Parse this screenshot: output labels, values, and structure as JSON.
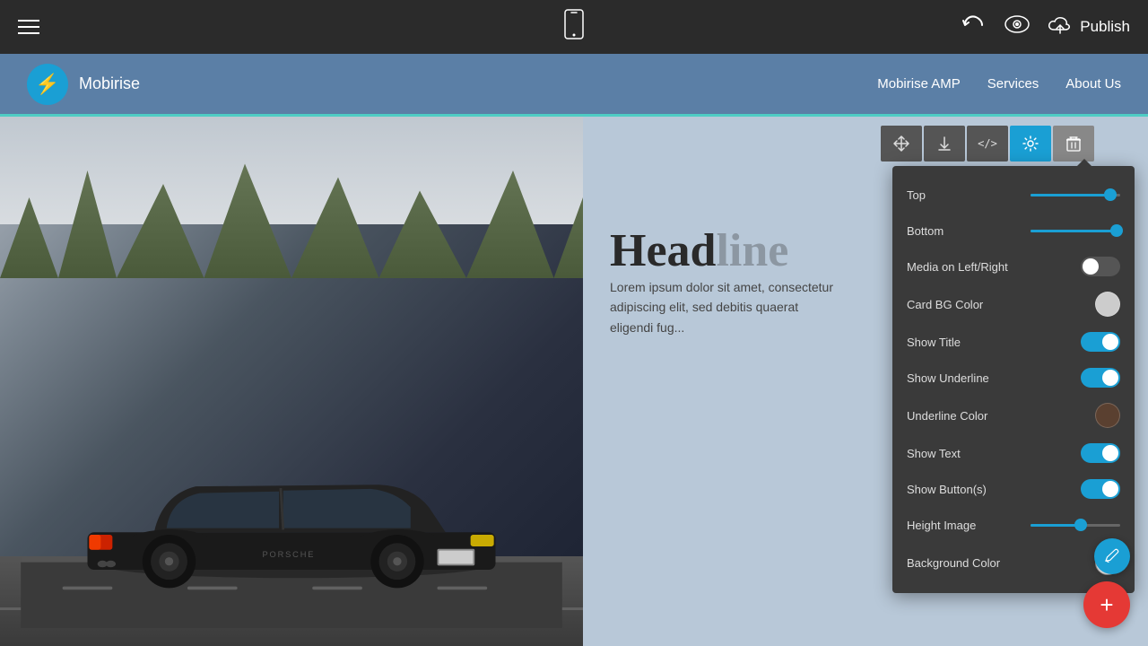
{
  "topbar": {
    "publish_label": "Publish",
    "phone_icon": "📱",
    "undo_icon": "↩",
    "eye_icon": "👁",
    "cloud_icon": "☁"
  },
  "site_header": {
    "logo_icon": "⚡",
    "site_name": "Mobirise",
    "nav": [
      {
        "label": "Mobirise AMP"
      },
      {
        "label": "Services"
      },
      {
        "label": "About Us"
      }
    ]
  },
  "content": {
    "heading": "Head",
    "body_text": "Lorem ipsum dolor sit amet, consectetur adipiscing elit, sed debitis quaerat eligendi fug..."
  },
  "settings_panel": {
    "title": "Settings",
    "rows": [
      {
        "label": "Top",
        "control": "slider",
        "value": 90
      },
      {
        "label": "Bottom",
        "control": "slider",
        "value": 95
      },
      {
        "label": "Media on Left/Right",
        "control": "toggle",
        "state": "off"
      },
      {
        "label": "Card BG Color",
        "control": "color",
        "color": "#cccccc"
      },
      {
        "label": "Show Title",
        "control": "toggle",
        "state": "on"
      },
      {
        "label": "Show Underline",
        "control": "toggle",
        "state": "on"
      },
      {
        "label": "Underline Color",
        "control": "color",
        "color": "#5a4030"
      },
      {
        "label": "Show Text",
        "control": "toggle",
        "state": "on"
      },
      {
        "label": "Show Button(s)",
        "control": "toggle",
        "state": "on"
      },
      {
        "label": "Height Image",
        "control": "slider",
        "value": 55
      },
      {
        "label": "Background Color",
        "control": "color",
        "color": "#ffffff"
      }
    ]
  },
  "toolbar": {
    "buttons": [
      {
        "icon": "↕",
        "label": "move",
        "active": false
      },
      {
        "icon": "⬇",
        "label": "download",
        "active": false
      },
      {
        "icon": "</>",
        "label": "code",
        "active": false
      },
      {
        "icon": "⚙",
        "label": "settings",
        "active": true
      },
      {
        "icon": "🗑",
        "label": "delete",
        "active": false
      }
    ]
  },
  "fab": {
    "add_icon": "+",
    "pencil_icon": "✏"
  }
}
